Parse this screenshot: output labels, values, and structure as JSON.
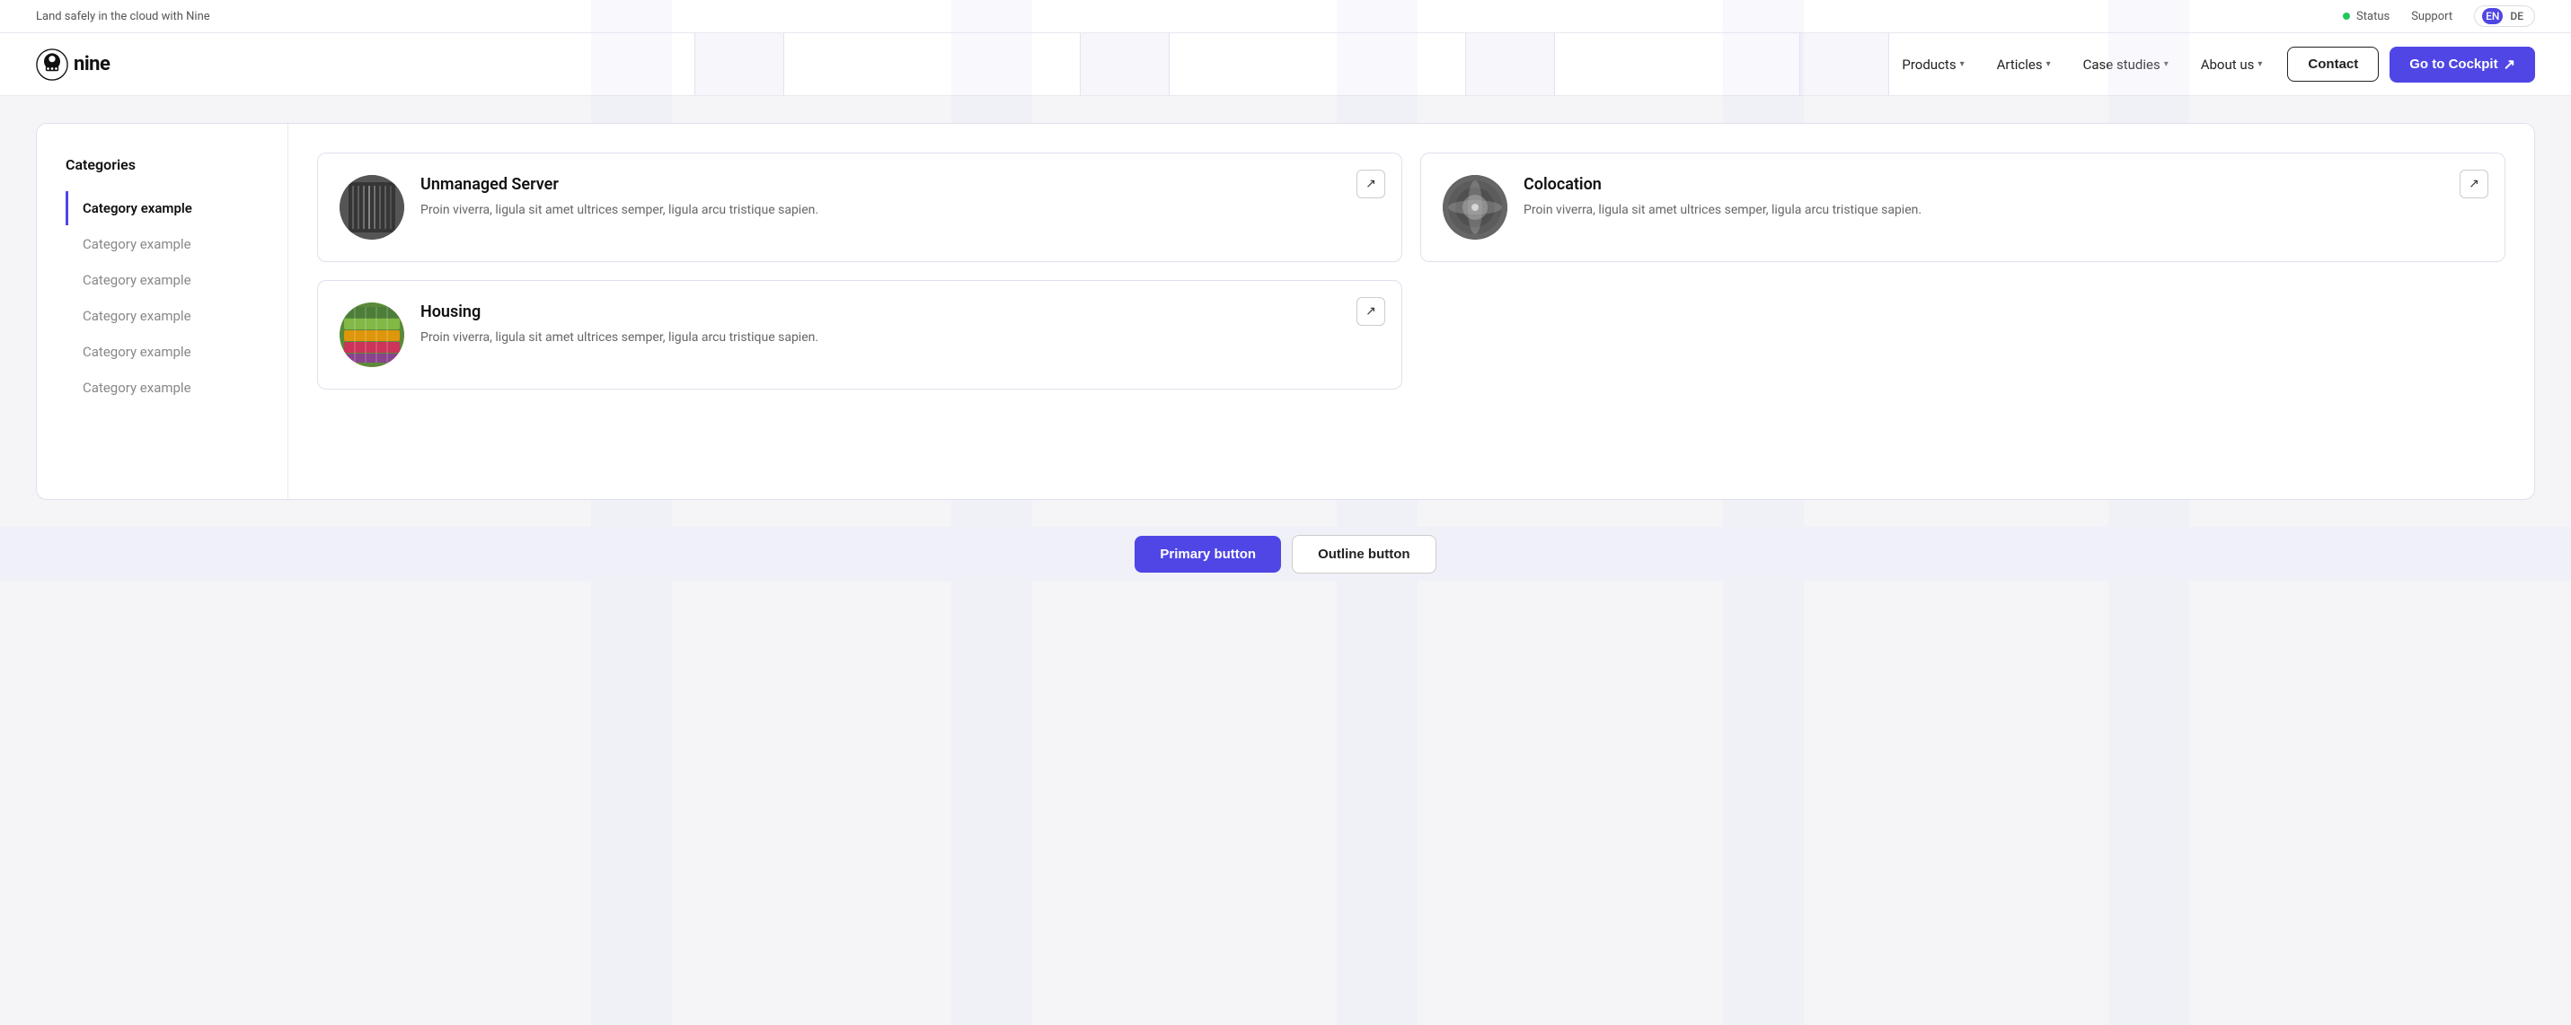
{
  "topbar": {
    "tagline": "Land safely in the cloud with Nine",
    "status_label": "Status",
    "support_label": "Support",
    "lang_en": "EN",
    "lang_de": "DE"
  },
  "header": {
    "logo_text": "nine",
    "nav": [
      {
        "label": "Products",
        "id": "products"
      },
      {
        "label": "Articles",
        "id": "articles"
      },
      {
        "label": "Case studies",
        "id": "case-studies"
      },
      {
        "label": "About us",
        "id": "about-us"
      }
    ],
    "contact_label": "Contact",
    "cockpit_label": "Go to Cockpit"
  },
  "panel": {
    "sidebar": {
      "title": "Categories",
      "items": [
        {
          "label": "Category example",
          "active": true
        },
        {
          "label": "Category example",
          "active": false
        },
        {
          "label": "Category example",
          "active": false
        },
        {
          "label": "Category example",
          "active": false
        },
        {
          "label": "Category example",
          "active": false
        },
        {
          "label": "Category example",
          "active": false
        }
      ]
    },
    "cards": [
      {
        "title": "Unmanaged Server",
        "desc": "Proin viverra, ligula sit amet ultrices semper, ligula arcu tristique sapien.",
        "img_type": "server"
      },
      {
        "title": "Colocation",
        "desc": "Proin viverra, ligula sit amet ultrices semper, ligula arcu tristique sapien.",
        "img_type": "colocation"
      },
      {
        "title": "Housing",
        "desc": "Proin viverra, ligula sit amet ultrices semper, ligula arcu tristique sapien.",
        "img_type": "housing"
      }
    ]
  },
  "bottom": {
    "primary_btn": "Primary button",
    "outline_btn": "Outline button"
  }
}
